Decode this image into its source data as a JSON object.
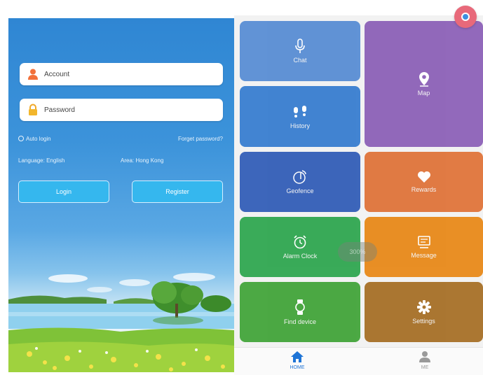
{
  "login": {
    "account_placeholder": "Account",
    "password_placeholder": "Password",
    "auto_login": "Auto login",
    "forgot_password": "Forget password?",
    "language_label": "Language:",
    "language_value": "English",
    "area_label": "Area:",
    "area_value": "Hong Kong",
    "login_button": "Login",
    "register_button": "Register"
  },
  "tiles": {
    "chat": {
      "label": "Chat",
      "color": "#5b8fd4",
      "icon": "microphone-icon"
    },
    "map": {
      "label": "Map",
      "color": "#8e63b8",
      "icon": "location-pin-icon"
    },
    "history": {
      "label": "History",
      "color": "#3a7fd0",
      "icon": "footprints-icon"
    },
    "geofence": {
      "label": "Geofence",
      "color": "#3560b8",
      "icon": "geofence-icon"
    },
    "rewards": {
      "label": "Rewards",
      "color": "#e0763c",
      "icon": "heart-icon"
    },
    "alarm": {
      "label": "Alarm Clock",
      "color": "#32a852",
      "icon": "alarm-clock-icon"
    },
    "message": {
      "label": "Message",
      "color": "#e88a1c",
      "icon": "message-icon"
    },
    "find": {
      "label": "Find device",
      "color": "#45a63c",
      "icon": "watch-icon"
    },
    "settings": {
      "label": "Settings",
      "color": "#a8712a",
      "icon": "gear-icon"
    }
  },
  "tabbar": {
    "home": "HOME",
    "me": "ME",
    "home_color": "#1e74d6",
    "me_color": "#9a9a9a"
  },
  "overlay": {
    "zoom": "300%"
  }
}
